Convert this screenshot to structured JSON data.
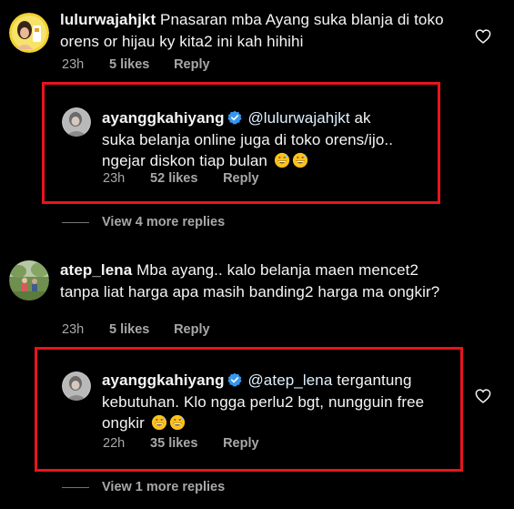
{
  "comments": [
    {
      "username": "lulurwajahjkt",
      "text": "Pnasaran mba Ayang suka blanja di toko orens or hijau ky kita2 ini kah hihihi",
      "time": "23h",
      "likes": "5 likes",
      "reply": "Reply",
      "reply_comment": {
        "username": "ayanggkahiyang",
        "mention": "@lulurwajahjkt",
        "text": " ak suka belanja online juga di toko orens/ijo.. ngejar diskon tiap bulan",
        "time": "23h",
        "likes": "52 likes",
        "reply": "Reply"
      },
      "view_more": "View 4 more replies"
    },
    {
      "username": "atep_lena",
      "text": "Mba ayang.. kalo belanja maen mencet2 tanpa liat harga apa masih banding2 harga ma ongkir?",
      "time": "23h",
      "likes": "5 likes",
      "reply": "Reply",
      "reply_comment": {
        "username": "ayanggkahiyang",
        "mention": "@atep_lena",
        "text": " tergantung kebutuhan. Klo ngga perlu2 bgt, nungguin free ongkir",
        "time": "22h",
        "likes": "35 likes",
        "reply": "Reply"
      },
      "view_more": "View 1 more replies"
    }
  ],
  "icons": {
    "like": "heart-outline-icon",
    "verified": "verified-badge-icon",
    "emoji": "grinning-sweat-emoji"
  },
  "colors": {
    "background": "#000000",
    "text": "#f5f5f5",
    "secondary": "#a8a8a8",
    "verified": "#3797f0",
    "highlight": "#e8141c"
  }
}
